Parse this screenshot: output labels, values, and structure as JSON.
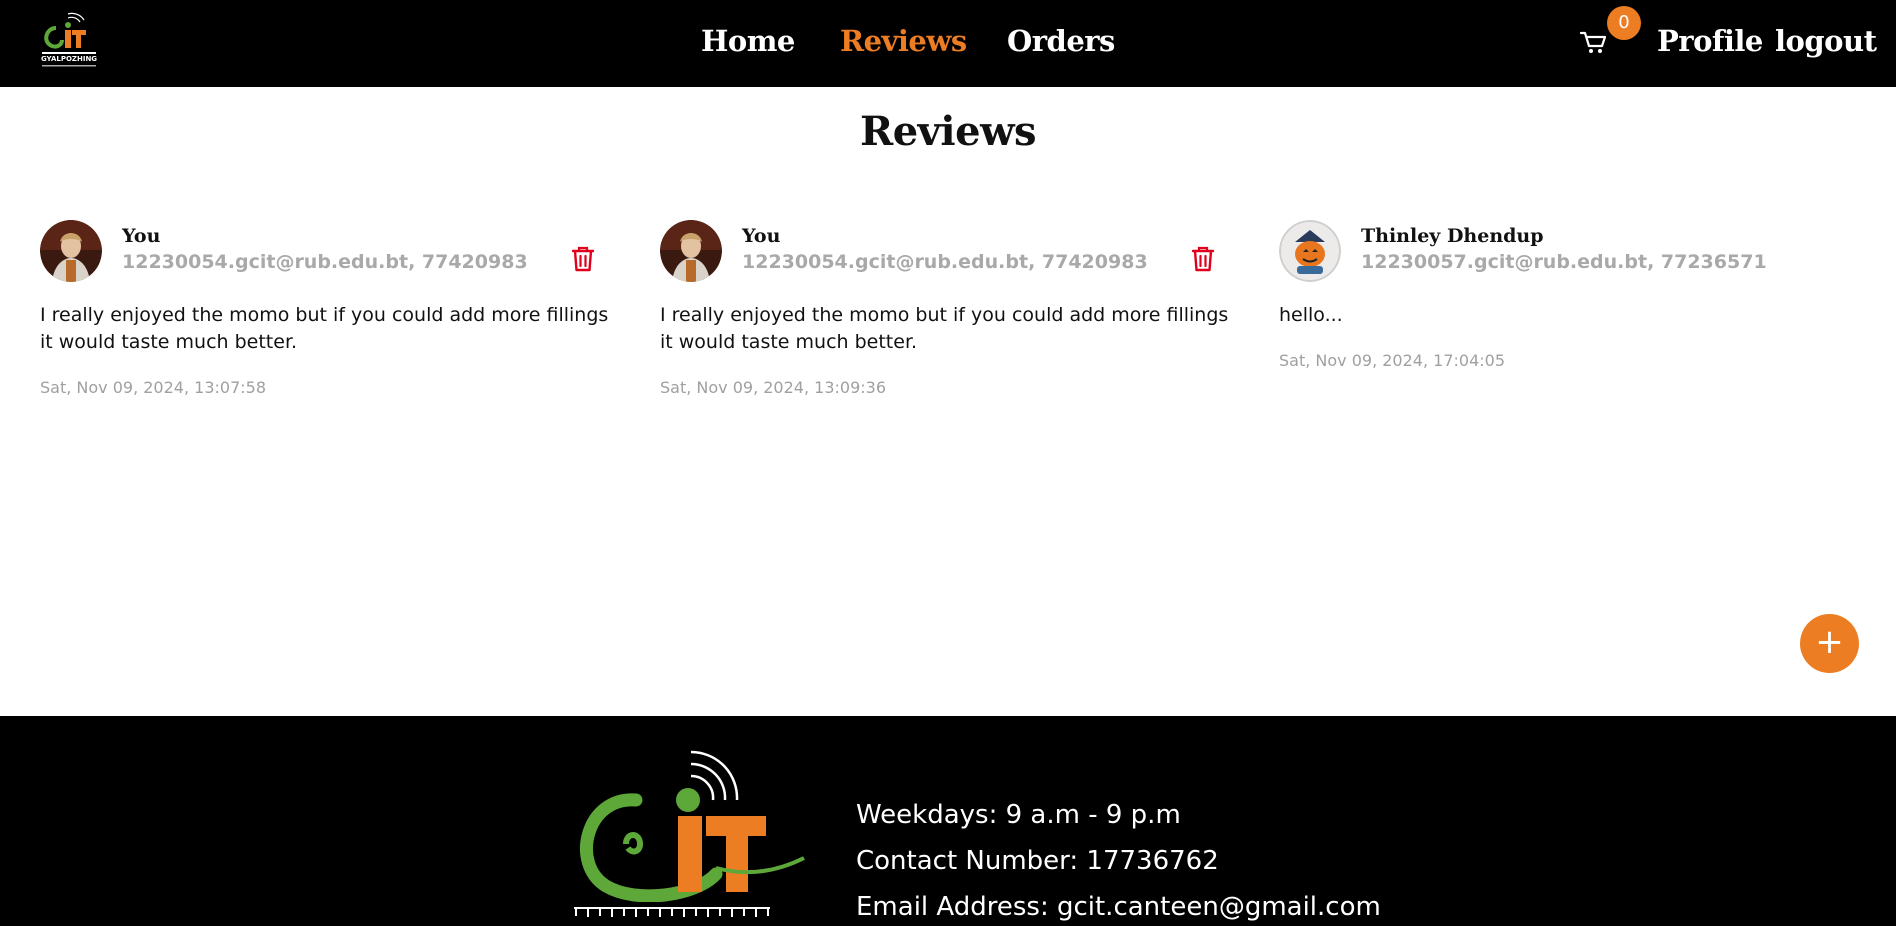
{
  "navbar": {
    "links": {
      "home": "Home",
      "reviews": "Reviews",
      "orders": "Orders",
      "profile": "Profile",
      "logout": "logout"
    },
    "cart_count": "0",
    "active": "Reviews",
    "logo_text": "GYALPOZHING",
    "logo_icon": "gcit-logo-icon",
    "cart_icon": "cart-icon"
  },
  "page": {
    "title": "Reviews"
  },
  "reviews": [
    {
      "author": "You",
      "contact": "12230054.gcit@rub.edu.bt, 77420983",
      "comment": "I really enjoyed the momo but if you could add more fillings it would taste much better.",
      "timestamp": "Sat, Nov 09, 2024, 13:07:58",
      "deletable": true
    },
    {
      "author": "You",
      "contact": "12230054.gcit@rub.edu.bt, 77420983",
      "comment": "I really enjoyed the momo but if you could add more fillings it would taste much better.",
      "timestamp": "Sat, Nov 09, 2024, 13:09:36",
      "deletable": true
    },
    {
      "author": "Thinley Dhendup",
      "contact": "12230057.gcit@rub.edu.bt, 77236571",
      "comment": "hello...",
      "timestamp": "Sat, Nov 09, 2024, 17:04:05",
      "deletable": false
    }
  ],
  "fab": {
    "label": "+"
  },
  "footer": {
    "weekdays": "Weekdays: 9 a.m - 9 p.m",
    "contact": "Contact Number: 17736762",
    "email": "Email Address: gcit.canteen@gmail.com"
  },
  "colors": {
    "accent": "#ec7d22",
    "nav_bg": "#000000",
    "delete": "#e0001b",
    "muted": "#a9a9a9"
  }
}
